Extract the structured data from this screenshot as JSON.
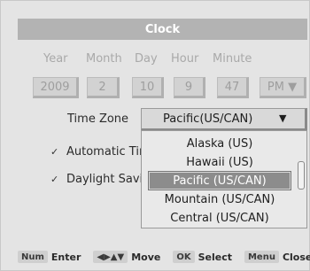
{
  "window": {
    "title": "Clock"
  },
  "columns": {
    "year": "Year",
    "month": "Month",
    "day": "Day",
    "hour": "Hour",
    "minute": "Minute"
  },
  "fields": {
    "year": "2009",
    "month": "2",
    "day": "10",
    "hour": "9",
    "minute": "47",
    "ampm": "PM ▼"
  },
  "timezone": {
    "label": "Time Zone",
    "value": "Pacific(US/CAN)",
    "arrow": "▼",
    "options": [
      "Alaska (US)",
      "Hawaii (US)",
      "Pacific (US/CAN)",
      "Mountain (US/CAN)",
      "Central (US/CAN)"
    ],
    "selected_index": 2
  },
  "checks": {
    "automatic": {
      "label": "Automatic Tim",
      "checked": true,
      "mark": "✓"
    },
    "dst": {
      "label": "Daylight Savin",
      "checked": true,
      "mark": "✓"
    }
  },
  "footer": {
    "items": [
      {
        "key": "Num",
        "action": "Enter"
      },
      {
        "key": "◀▶▲▼",
        "action": "Move"
      },
      {
        "key": "OK",
        "action": "Select"
      },
      {
        "key": "Menu",
        "action": "Close"
      }
    ]
  },
  "colors": {
    "titlebar": "#b3b3b3",
    "panel": "#e4e4e4",
    "selection": "#8c8c8c"
  }
}
